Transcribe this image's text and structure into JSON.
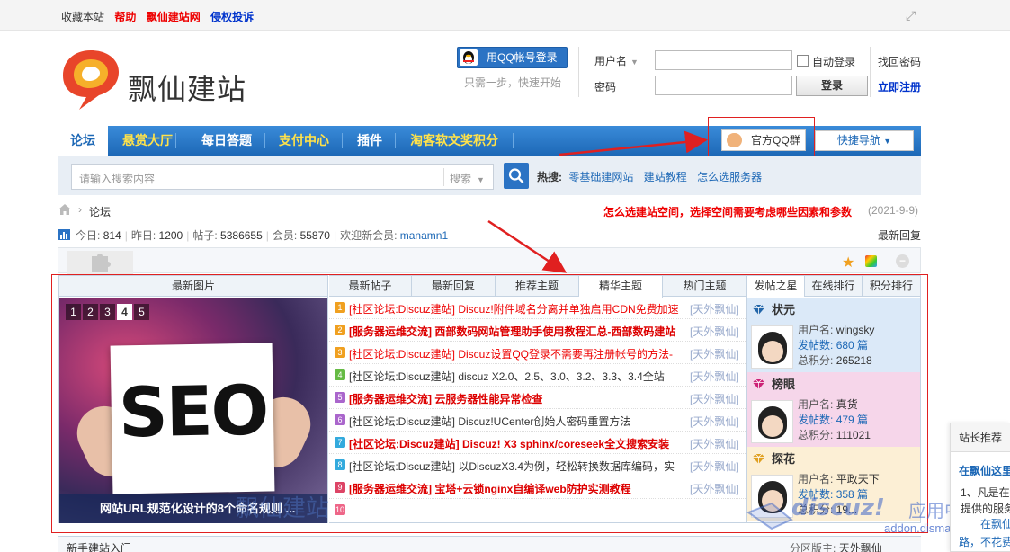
{
  "topbar": {
    "links": [
      {
        "label": "收藏本站",
        "style": "plain"
      },
      {
        "label": "帮助",
        "style": "red"
      },
      {
        "label": "飘仙建站网",
        "style": "red"
      },
      {
        "label": "侵权投诉",
        "style": "blue"
      }
    ]
  },
  "header": {
    "site_name": "飘仙建站",
    "qq_login_label": "用QQ帐号登录",
    "qq_login_sub": "只需一步，快速开始",
    "username_label": "用户名",
    "password_label": "密码",
    "auto_login_label": "自动登录",
    "login_button": "登录",
    "find_password": "找回密码",
    "register": "立即注册"
  },
  "nav": {
    "items": [
      {
        "label": "论坛",
        "style": "active"
      },
      {
        "label": "悬赏大厅",
        "style": "yellow"
      },
      {
        "label": "每日答题",
        "style": "plain"
      },
      {
        "label": "支付中心",
        "style": "yellow"
      },
      {
        "label": "插件",
        "style": "plain"
      },
      {
        "label": "淘客软文奖积分",
        "style": "yellow"
      }
    ],
    "qq_group": "官方QQ群",
    "quick_nav": "快捷导航"
  },
  "search": {
    "placeholder": "请输入搜索内容",
    "type_label": "搜索",
    "hot_label": "热搜:",
    "hot_items": [
      "零基础建网站",
      "建站教程",
      "怎么选服务器"
    ]
  },
  "breadcrumb": {
    "forum": "论坛",
    "notice": "怎么选建站空间，选择空间需要考虑哪些因素和参数",
    "notice_date": "(2021-9-9)"
  },
  "stats": {
    "today_label": "今日:",
    "today": "814",
    "yesterday_label": "昨日:",
    "yesterday": "1200",
    "posts_label": "帖子:",
    "posts": "5386655",
    "members_label": "会员:",
    "members": "55870",
    "welcome_label": "欢迎新会员:",
    "new_member": "manamn1",
    "latest_reply": "最新回复"
  },
  "portal": {
    "image_col_title": "最新图片",
    "pager": [
      "1",
      "2",
      "3",
      "4",
      "5"
    ],
    "pager_active": 3,
    "seo_text": "SEO",
    "image_caption": "网站URL规范化设计的8个命名规则 ...",
    "watermark": "飘仙建站",
    "tabs": [
      "最新帖子",
      "最新回复",
      "推荐主题",
      "精华主题",
      "热门主题"
    ],
    "active_tab": 3,
    "threads": [
      {
        "num": "1",
        "color": "#f0a020",
        "title": "[社区论坛:Discuz建站] Discuz!附件域名分离并单独启用CDN免费加速",
        "style": "red",
        "src": "[天外飘仙]"
      },
      {
        "num": "2",
        "color": "#f0a020",
        "title": "[服务器运维交流] 西部数码网站管理助手使用教程汇总-西部数码建站",
        "style": "boldred",
        "src": "[天外飘仙]"
      },
      {
        "num": "3",
        "color": "#f0a020",
        "title": "[社区论坛:Discuz建站] Discuz设置QQ登录不需要再注册帐号的方法-",
        "style": "red",
        "src": "[天外飘仙]"
      },
      {
        "num": "4",
        "color": "#66bb44",
        "title": "[社区论坛:Discuz建站] discuz X2.0、2.5、3.0、3.2、3.3、3.4全站",
        "style": "plain",
        "src": "[天外飘仙]"
      },
      {
        "num": "5",
        "color": "#aa66cc",
        "title": "[服务器运维交流] 云服务器性能异常检查",
        "style": "boldred",
        "src": "[天外飘仙]"
      },
      {
        "num": "6",
        "color": "#aa66cc",
        "title": "[社区论坛:Discuz建站] Discuz!UCenter创始人密码重置方法",
        "style": "plain",
        "src": "[天外飘仙]"
      },
      {
        "num": "7",
        "color": "#33aadd",
        "title": "[社区论坛:Discuz建站] Discuz! X3 sphinx/coreseek全文搜索安装",
        "style": "boldred",
        "src": "[天外飘仙]"
      },
      {
        "num": "8",
        "color": "#33aadd",
        "title": "[社区论坛:Discuz建站] 以DiscuzX3.4为例，轻松转换数据库编码，实",
        "style": "plain",
        "src": "[天外飘仙]"
      },
      {
        "num": "9",
        "color": "#dd4466",
        "title": "[服务器运维交流] 宝塔+云锁nginx自编译web防护实测教程",
        "style": "boldred",
        "src": "[天外飘仙]"
      },
      {
        "num": "10",
        "color": "#ee6688",
        "title": "",
        "style": "plain",
        "src": ""
      }
    ],
    "rank_tabs": [
      "发帖之星",
      "在线排行",
      "积分排行"
    ],
    "ranks": [
      {
        "title": "状元",
        "bg": "#dbe9f8",
        "gem": "#2266aa",
        "user_label": "用户名:",
        "user": "wingsky",
        "posts_label": "发帖数:",
        "posts": "680 篇",
        "points_label": "总积分:",
        "points": "265218"
      },
      {
        "title": "榜眼",
        "bg": "#f6d6ea",
        "gem": "#cc2277",
        "user_label": "用户名:",
        "user": "真货",
        "posts_label": "发帖数:",
        "posts": "479 篇",
        "points_label": "总积分:",
        "points": "111021"
      },
      {
        "title": "探花",
        "bg": "#fcefd5",
        "gem": "#e0a020",
        "user_label": "用户名:",
        "user": "平政天下",
        "posts_label": "发帖数:",
        "posts": "358 篇",
        "points_label": "总积分:",
        "points": "19..."
      }
    ]
  },
  "bottom": {
    "newbie": "新手建站入门",
    "moderator_label": "分区版主:",
    "moderator": "天外飘仙"
  },
  "side_panel": {
    "title": "站长推荐",
    "line1": "在飘仙这里",
    "line2": "1、凡是在",
    "line3": "提供的服务",
    "line4": "在飘仙",
    "line5": "路，不花费"
  },
  "discuz_mark": {
    "brand": "discuz!",
    "app": "应用中心",
    "url": "addon.dismall.com"
  }
}
